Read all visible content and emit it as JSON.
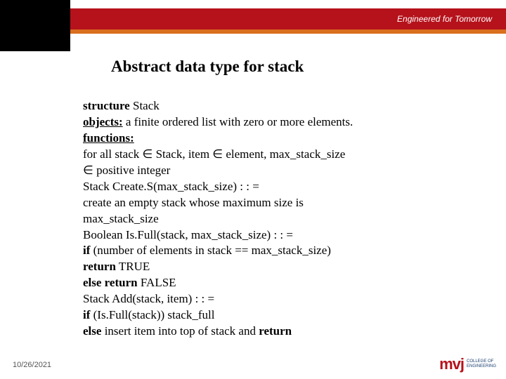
{
  "header": {
    "tagline": "Engineered for Tomorrow"
  },
  "title": "Abstract data type for stack",
  "body": {
    "structure_kw": "structure",
    "structure_name": " Stack",
    "objects_kw": "objects:",
    "objects_rest": " a finite ordered list with zero or more elements.",
    "functions_kw": "functions:",
    "l1a": "for all stack ",
    "l1b": " Stack, item ",
    "l1c": " element, max_stack_size",
    "l2a": " positive integer",
    "l3": "Stack Create.S(max_stack_size) : : =",
    "l4": " create an empty stack whose maximum size is",
    "l5": " max_stack_size",
    "l6": "Boolean Is.Full(stack, max_stack_size) : : =",
    "if_kw": " if",
    "l7": " (number of elements in stack == max_stack_size)",
    "return_kw": " return",
    "l8": " TRUE",
    "else_return_kw": " else return",
    "l9": " FALSE",
    "l10": "Stack Add(stack, item) : : =",
    "l11": " (Is.Full(stack)) stack_full",
    "else_kw": " else",
    "l12": " insert item into top of stack and ",
    "return_kw2": "return"
  },
  "elem": "∈",
  "footer": {
    "date": "10/26/2021"
  },
  "logo": {
    "mark": "mvj",
    "sub1": "COLLEGE OF",
    "sub2": "ENGINEERING"
  }
}
